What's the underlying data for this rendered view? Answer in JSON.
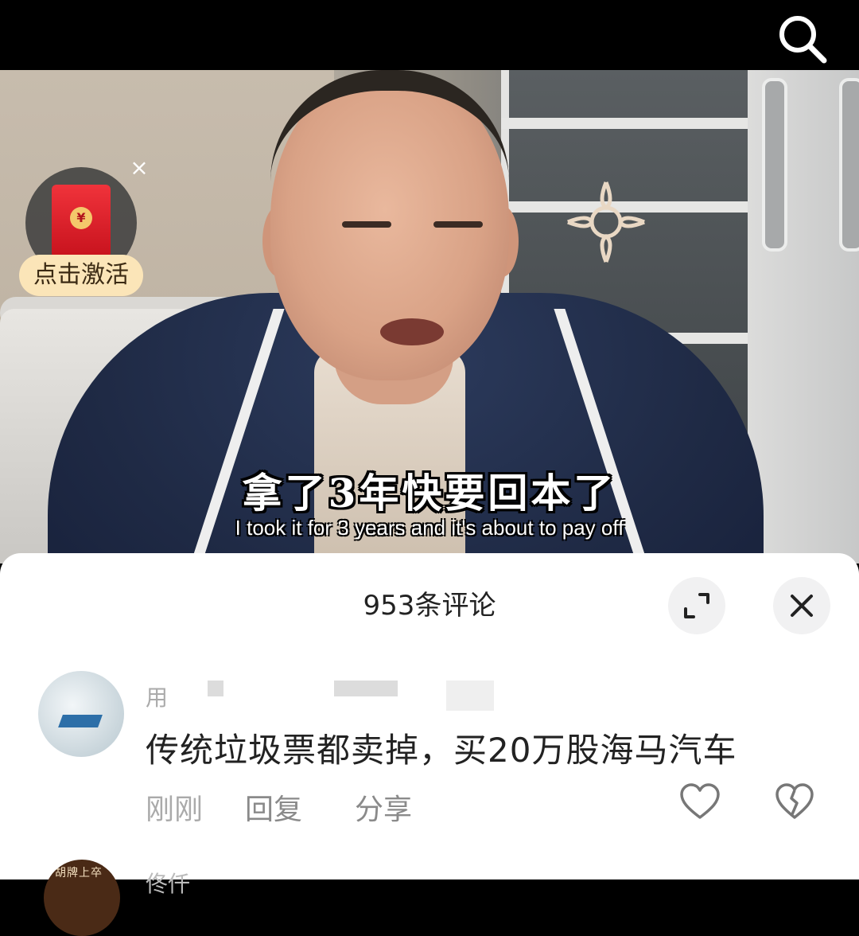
{
  "video": {
    "subtitle_zh": "拿了3年快要回本了",
    "subtitle_en": "I took it for 3 years and it's about to pay off",
    "icons": {
      "search": "search-icon"
    }
  },
  "red_packet": {
    "label": "点击激活",
    "close_glyph": "×",
    "coin_glyph": "¥",
    "icons": {
      "close": "close-icon",
      "packet": "red-envelope-icon"
    }
  },
  "comments_panel": {
    "title": "953条评论",
    "icons": {
      "expand": "expand-icon",
      "close": "close-icon"
    },
    "comments": [
      {
        "username": "用",
        "text": "传统垃圾票都卖掉，买20万股海马汽车",
        "time": "刚刚",
        "reply_label": "回复",
        "share_label": "分享",
        "icons": {
          "like": "heart-icon",
          "dislike": "broken-heart-icon"
        }
      },
      {
        "username": "佟仟",
        "avatar_text": "胡牌上卒"
      }
    ]
  },
  "colors": {
    "sheet_bg": "#ffffff",
    "packet_label_bg": "#fbe5b8",
    "packet_red": "#e0222b",
    "button_bg": "#f1f1f2"
  }
}
